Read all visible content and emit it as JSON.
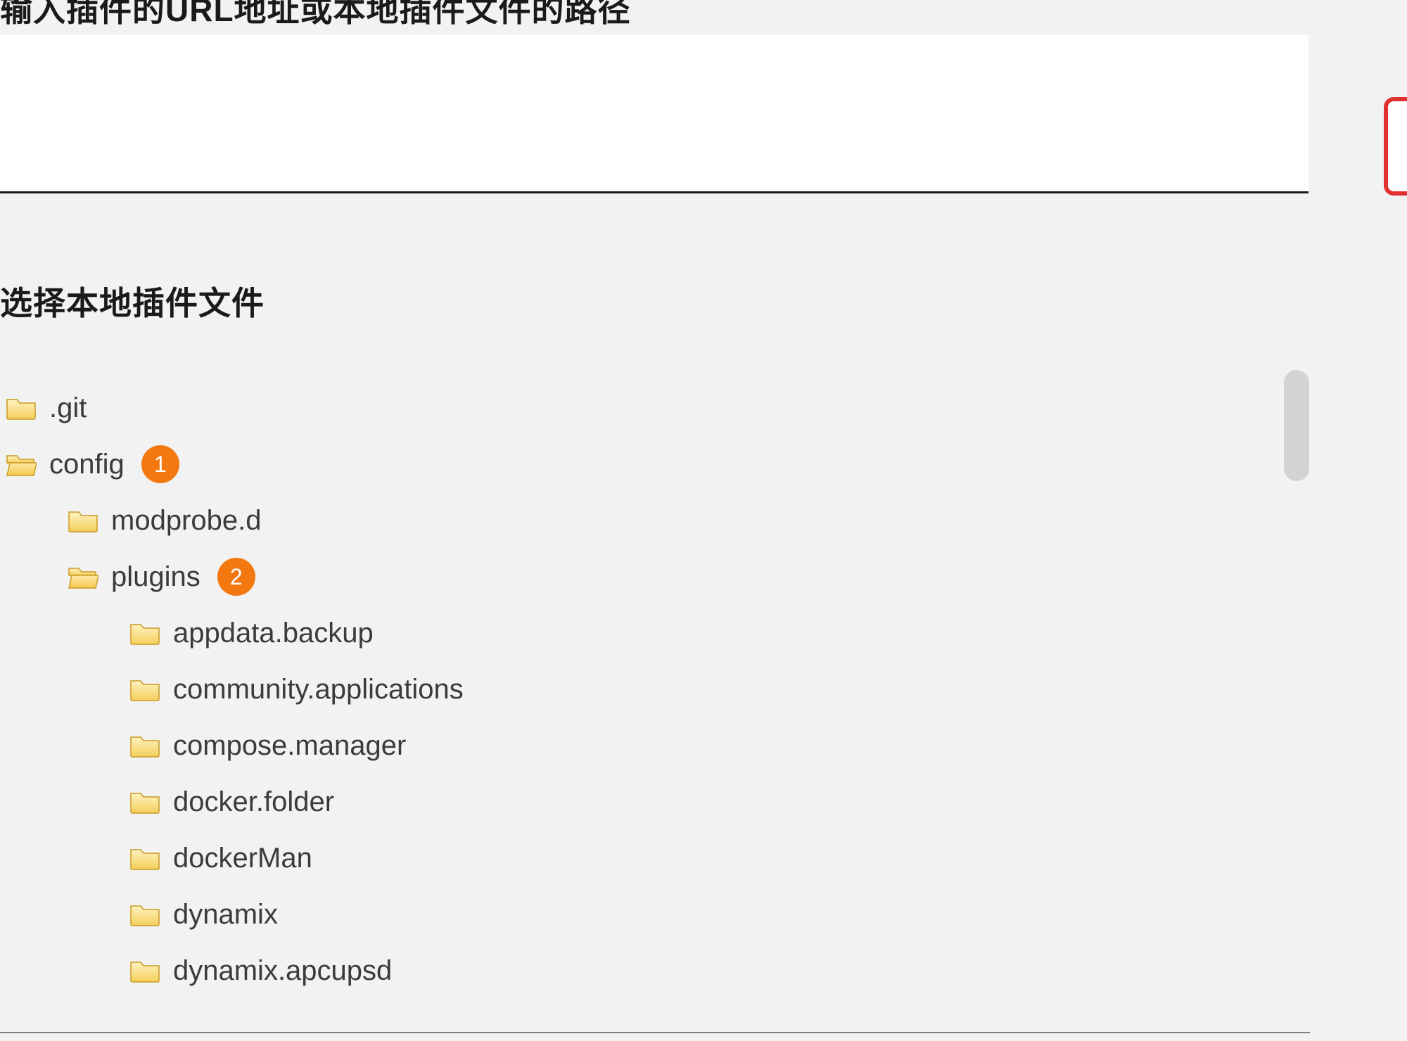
{
  "headings": {
    "top": "输入插件的URL地址或本地插件文件的路径",
    "section": "选择本地插件文件"
  },
  "tree": {
    "items": [
      {
        "label": ".git",
        "indent": 0,
        "open": false,
        "badge": null
      },
      {
        "label": "config",
        "indent": 0,
        "open": true,
        "badge": "1"
      },
      {
        "label": "modprobe.d",
        "indent": 1,
        "open": false,
        "badge": null
      },
      {
        "label": "plugins",
        "indent": 1,
        "open": true,
        "badge": "2"
      },
      {
        "label": "appdata.backup",
        "indent": 2,
        "open": false,
        "badge": null
      },
      {
        "label": "community.applications",
        "indent": 2,
        "open": false,
        "badge": null
      },
      {
        "label": "compose.manager",
        "indent": 2,
        "open": false,
        "badge": null
      },
      {
        "label": "docker.folder",
        "indent": 2,
        "open": false,
        "badge": null
      },
      {
        "label": "dockerMan",
        "indent": 2,
        "open": false,
        "badge": null
      },
      {
        "label": "dynamix",
        "indent": 2,
        "open": false,
        "badge": null
      },
      {
        "label": "dynamix.apcupsd",
        "indent": 2,
        "open": false,
        "badge": null
      }
    ]
  },
  "colors": {
    "badge_bg": "#f2780f",
    "badge_fg": "#ffffff",
    "accent_red": "#e03030"
  }
}
